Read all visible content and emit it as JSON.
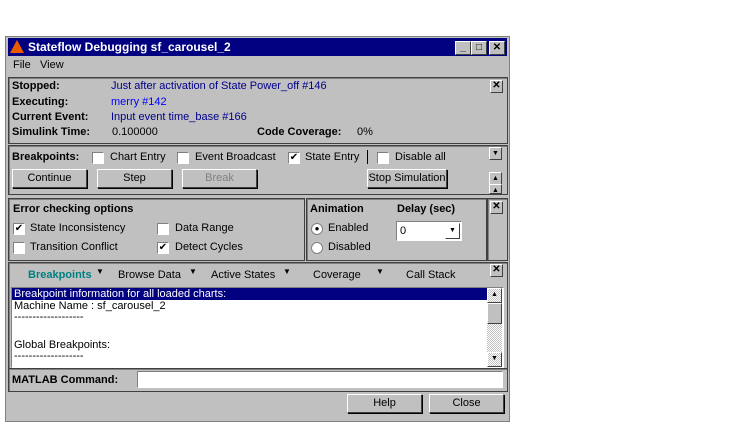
{
  "window": {
    "title": "Stateflow Debugging sf_carousel_2"
  },
  "menu": [
    "File",
    "View"
  ],
  "status": {
    "stopped_label": "Stopped:",
    "stopped": "Just after activation of State Power_off #146",
    "executing_label": "Executing:",
    "executing": "merry #142",
    "event_label": "Current Event:",
    "event": "Input event time_base #166",
    "time_label": "Simulink Time:",
    "time": "0.100000",
    "coverage_label": "Code Coverage:",
    "coverage": "0%"
  },
  "breakpoints": {
    "label": "Breakpoints:",
    "chart_entry": "Chart Entry",
    "event_broadcast": "Event Broadcast",
    "state_entry": "State Entry",
    "disable_all": "Disable all",
    "chart_entry_checked": false,
    "event_broadcast_checked": false,
    "state_entry_checked": true,
    "disable_all_checked": false
  },
  "buttons": {
    "continue": "Continue",
    "step": "Step",
    "break": "Break",
    "stop": "Stop Simulation",
    "help": "Help",
    "close": "Close"
  },
  "errors": {
    "title": "Error checking options",
    "state_inconsistency": "State Inconsistency",
    "transition_conflict": "Transition Conflict",
    "data_range": "Data Range",
    "detect_cycles": "Detect Cycles"
  },
  "animation": {
    "title": "Animation",
    "enabled": "Enabled",
    "disabled": "Disabled",
    "selected": "Enabled",
    "delay_label": "Delay (sec)",
    "delay": "0"
  },
  "tabs": [
    "Breakpoints",
    "Browse Data",
    "Active States",
    "Coverage",
    "Call Stack"
  ],
  "output": [
    "Breakpoint information for all loaded charts:",
    "Machine Name : sf_carousel_2",
    "-------------------",
    "",
    "Global Breakpoints:",
    "-------------------"
  ],
  "command": {
    "label": "MATLAB Command:",
    "value": ""
  },
  "colors": {
    "title_bar": "#000080",
    "active_tab": "#008080",
    "status_text": "#00008b"
  }
}
